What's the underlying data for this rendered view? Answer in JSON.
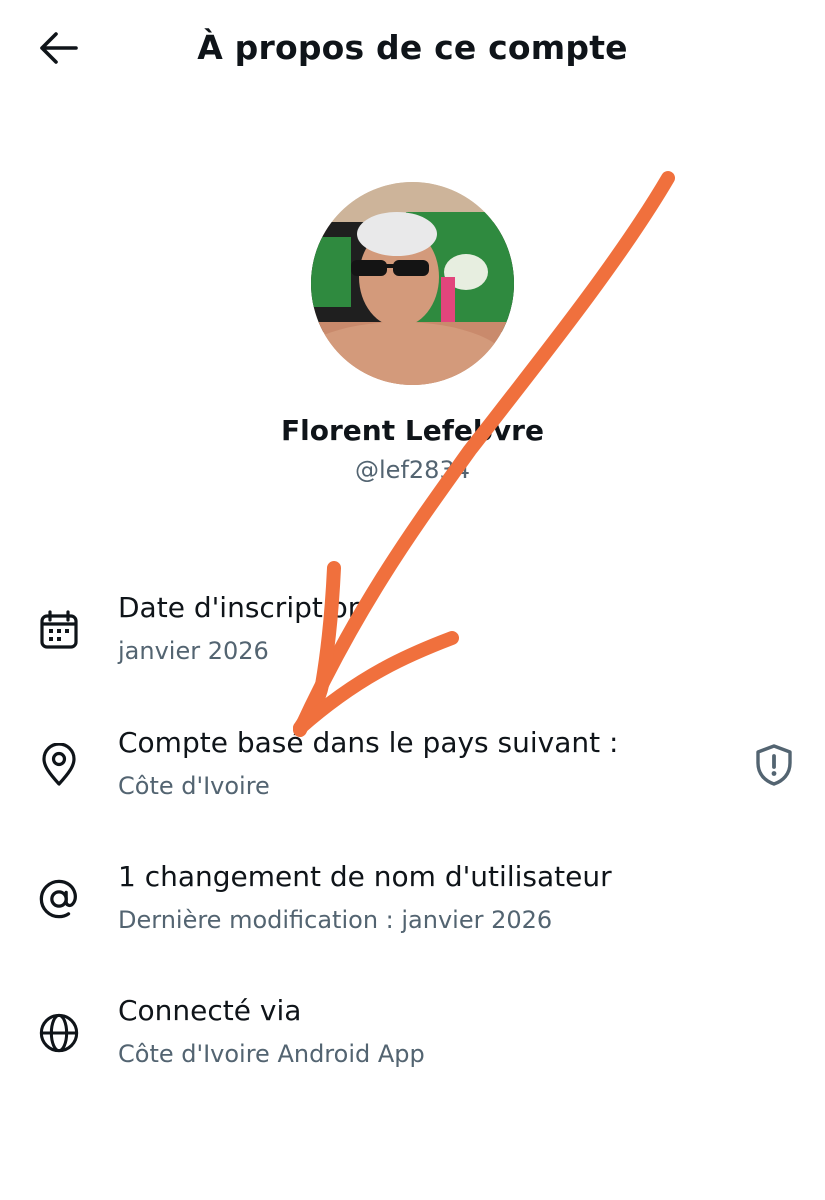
{
  "header": {
    "title": "À propos de ce compte",
    "back_icon": "arrow-left-icon"
  },
  "profile": {
    "display_name": "Florent Lefebvre",
    "handle": "@lef2834"
  },
  "rows": [
    {
      "icon": "calendar-icon",
      "title": "Date d'inscription",
      "subtitle": "janvier 2026"
    },
    {
      "icon": "location-pin-icon",
      "title": "Compte basé dans le pays suivant :",
      "subtitle": "Côte d'Ivoire",
      "action_icon": "shield-alert-icon"
    },
    {
      "icon": "at-sign-icon",
      "title": "1 changement de nom d'utilisateur",
      "subtitle": "Dernière modification : janvier 2026"
    },
    {
      "icon": "globe-icon",
      "title": "Connecté via",
      "subtitle": "Côte d'Ivoire Android App"
    }
  ],
  "colors": {
    "text": "#0f1419",
    "secondary": "#536471",
    "annotation": "#f0703d"
  }
}
